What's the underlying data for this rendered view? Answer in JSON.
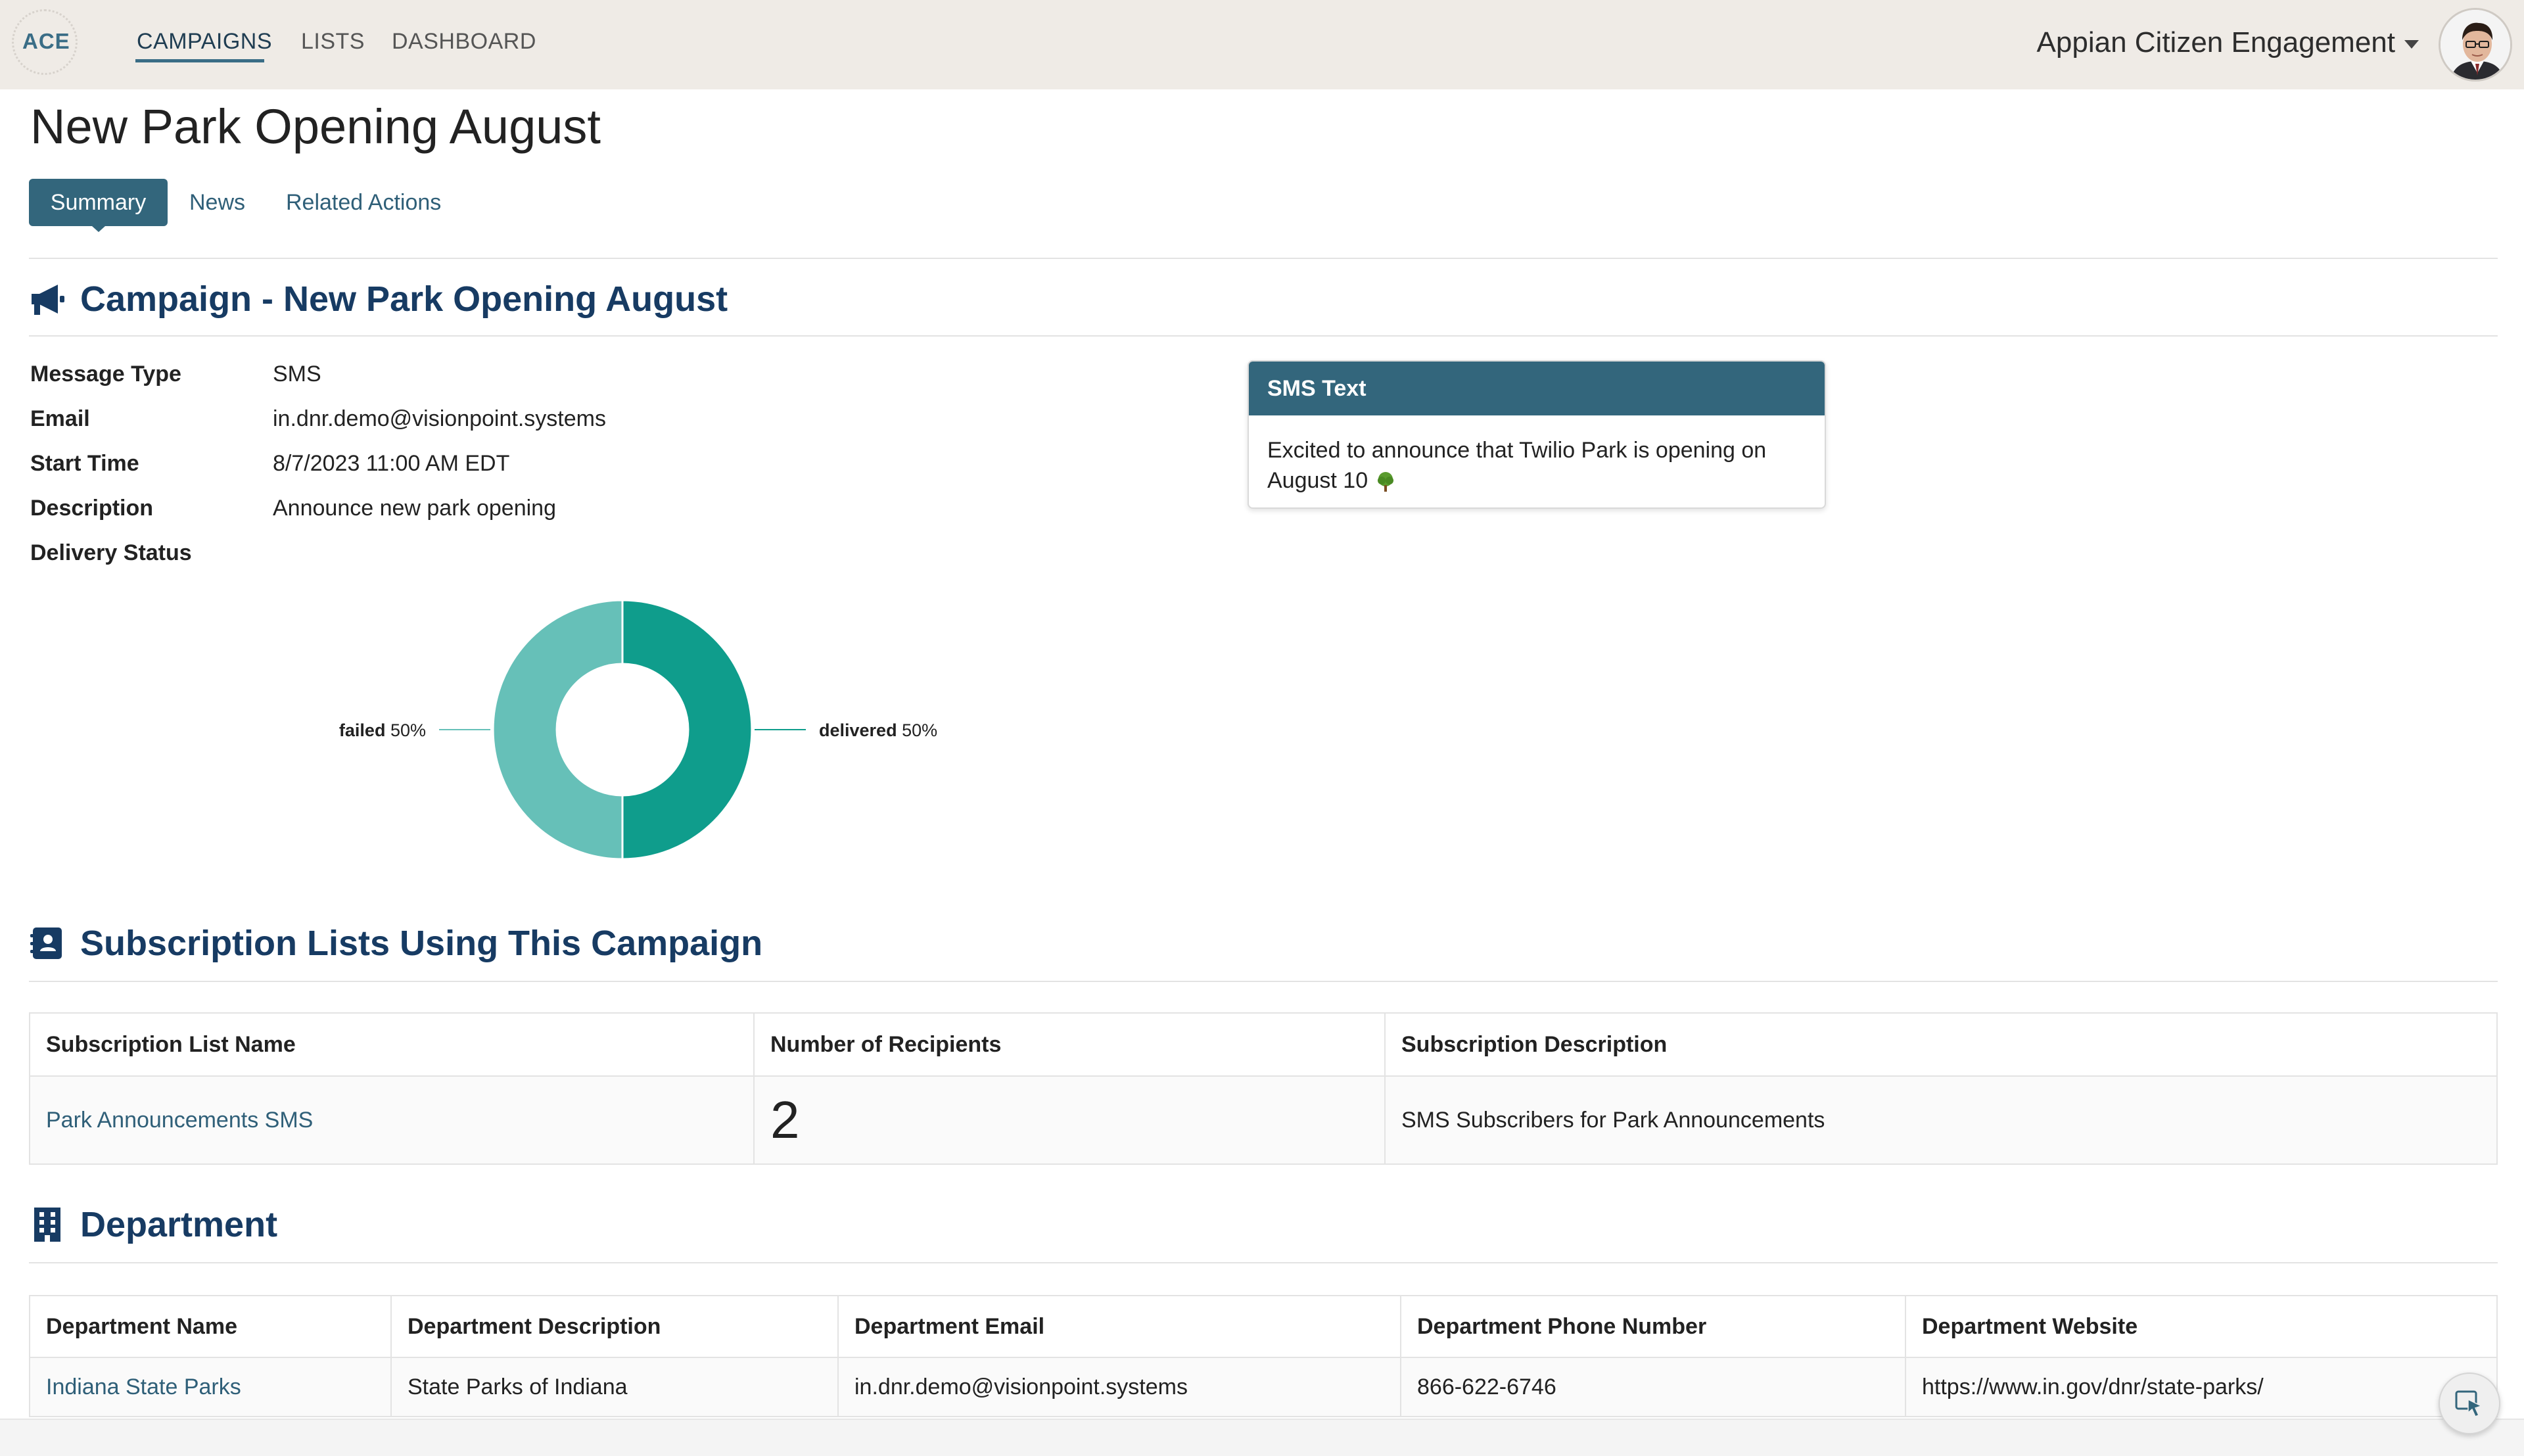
{
  "app": {
    "logo": "ACE",
    "nav": [
      {
        "label": "CAMPAIGNS",
        "active": true
      },
      {
        "label": "LISTS",
        "active": false
      },
      {
        "label": "DASHBOARD",
        "active": false
      }
    ],
    "account_name": "Appian Citizen Engagement",
    "avatar_icon": "user-avatar"
  },
  "page": {
    "title": "New Park Opening August",
    "tabs": [
      {
        "label": "Summary",
        "selected": true
      },
      {
        "label": "News",
        "selected": false
      },
      {
        "label": "Related Actions",
        "selected": false
      }
    ]
  },
  "campaign": {
    "heading": "Campaign - New Park Opening August",
    "heading_icon": "megaphone-icon",
    "fields": [
      {
        "label": "Message Type",
        "value": "SMS"
      },
      {
        "label": "Email",
        "value": "in.dnr.demo@visionpoint.systems"
      },
      {
        "label": "Start Time",
        "value": "8/7/2023 11:00 AM EDT"
      },
      {
        "label": "Description",
        "value": "Announce new park opening"
      },
      {
        "label": "Delivery Status",
        "value": ""
      }
    ],
    "sms_card": {
      "title": "SMS Text",
      "body": "Excited to announce that Twilio Park is opening on August 10",
      "emoji_icon": "tree-icon"
    }
  },
  "chart_data": {
    "type": "pie",
    "donut": true,
    "categories": [
      "delivered",
      "failed"
    ],
    "values": [
      50,
      50
    ],
    "labels": [
      "delivered 50%",
      "failed 50%"
    ],
    "colors": [
      "#0f9d8c",
      "#66c0b8"
    ]
  },
  "subscriptions": {
    "heading": "Subscription Lists Using This Campaign",
    "heading_icon": "contact-book-icon",
    "columns": [
      "Subscription List Name",
      "Number of Recipients",
      "Subscription Description"
    ],
    "rows": [
      {
        "name": "Park Announcements SMS",
        "recipients": "2",
        "description": "SMS Subscribers for Park Announcements"
      }
    ]
  },
  "department": {
    "heading": "Department",
    "heading_icon": "building-icon",
    "columns": [
      "Department Name",
      "Department Description",
      "Department Email",
      "Department Phone Number",
      "Department Website"
    ],
    "rows": [
      {
        "name": "Indiana State Parks",
        "description": "State Parks of Indiana",
        "email": "in.dnr.demo@visionpoint.systems",
        "phone": "866-622-6746",
        "website": "https://www.in.gov/dnr/state-parks/"
      }
    ]
  },
  "colors": {
    "topbar": "#efebe6",
    "accent": "#33667c",
    "heading": "#173b63",
    "link": "#2f5f78"
  }
}
